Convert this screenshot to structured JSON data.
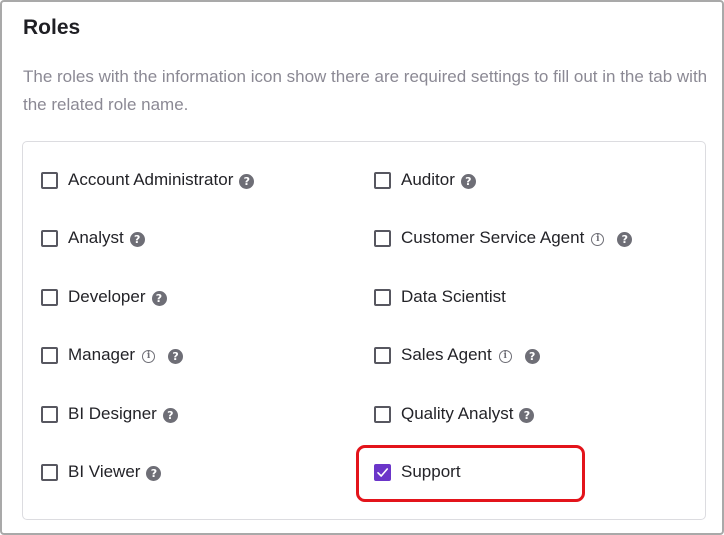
{
  "section": {
    "title": "Roles",
    "description": "The roles with the information icon show there are required settings to fill out in the tab with the related role name."
  },
  "roles": [
    {
      "label": "Account Administrator",
      "checked": false,
      "info": false,
      "help": true
    },
    {
      "label": "Auditor",
      "checked": false,
      "info": false,
      "help": true
    },
    {
      "label": "Analyst",
      "checked": false,
      "info": false,
      "help": true
    },
    {
      "label": "Customer Service Agent",
      "checked": false,
      "info": true,
      "help": true
    },
    {
      "label": "Developer",
      "checked": false,
      "info": false,
      "help": true
    },
    {
      "label": "Data Scientist",
      "checked": false,
      "info": false,
      "help": false
    },
    {
      "label": "Manager",
      "checked": false,
      "info": true,
      "help": true
    },
    {
      "label": "Sales Agent",
      "checked": false,
      "info": true,
      "help": true
    },
    {
      "label": "BI Designer",
      "checked": false,
      "info": false,
      "help": true
    },
    {
      "label": "Quality Analyst",
      "checked": false,
      "info": false,
      "help": true
    },
    {
      "label": "BI Viewer",
      "checked": false,
      "info": false,
      "help": true
    },
    {
      "label": "Support",
      "checked": true,
      "info": false,
      "help": false
    }
  ],
  "colors": {
    "accent": "#6b35c9",
    "highlight": "#e3141b"
  },
  "icons": {
    "help": "?",
    "info": "i"
  }
}
